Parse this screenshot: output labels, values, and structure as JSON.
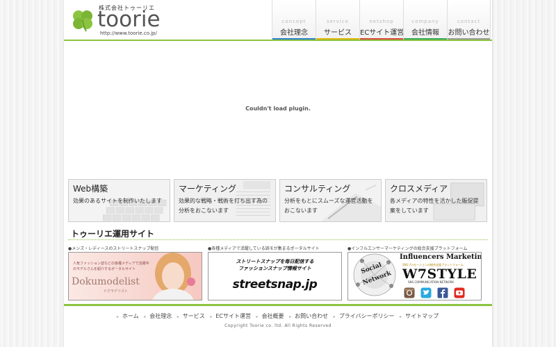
{
  "header": {
    "company_small": "株式会社トゥーリエ",
    "logo_word": "toorie",
    "url": "http://www.toorie.co.jp/"
  },
  "nav": [
    {
      "en": "concept",
      "ja": "会社理念",
      "color": "#2c7fc8"
    },
    {
      "en": "service",
      "ja": "サービス",
      "color": "#e0b50f"
    },
    {
      "en": "netshop",
      "ja": "ECサイト運営",
      "color": "#d94a3a"
    },
    {
      "en": "company",
      "ja": "会社情報",
      "color": "#39a95a"
    },
    {
      "en": "contact",
      "ja": "お問い合わせ",
      "color": "#9b9b9b"
    }
  ],
  "plugin_message": "Couldn't load plugin.",
  "services": [
    {
      "title": "Web構築",
      "desc": "効果のあるサイトを制作いたします"
    },
    {
      "title": "マーケティング",
      "desc": "効果的な戦略・戦術を打ち出す為の分析をおこないます"
    },
    {
      "title": "コンサルティング",
      "desc": "分析をもとにスムーズな運営活動をおこないます"
    },
    {
      "title": "クロスメディア",
      "desc": "各メディアの特性を活かした販促提案をしています"
    }
  ],
  "section_title": "トゥーリエ運用サイト",
  "sites": [
    {
      "label": "●メンズ・レディースのストリートスナップ配信",
      "banner_text_small": "人気ファッション誌などの各種メディアで活躍中のモデルさんを紹介するポータルサイト",
      "banner_logo": "Dokumodelist",
      "banner_logo_sub": "ドクモデリスト"
    },
    {
      "label": "●各種メディアで活躍している読モが集まるポータルサイト",
      "banner_line1": "ストリートスナップを毎日配信する",
      "banner_line2": "ファッションスナップ情報サイト",
      "banner_logo": "streetsnap.jp"
    },
    {
      "label": "●インフルエンサーマーケティングの総合支援プラットフォーム",
      "banner_title": "Influencers Marketing",
      "banner_sub": "SNSプロモーションの総合支援プラットフォーム",
      "banner_logo": "W7STYLE",
      "banner_logo_sub": "SNS COMMUNICATION NETWORK",
      "social_text_1": "Social",
      "social_text_2": "Network"
    }
  ],
  "footer": {
    "links": [
      "ホーム",
      "会社理念",
      "サービス",
      "ECサイト運営",
      "会社概要",
      "お問い合わせ",
      "プライバシーポリシー",
      "サイトマップ"
    ],
    "copyright": "Copyright Toorie co. ltd. All Rights Reserved"
  },
  "colors": {
    "accent_green": "#8bc43f"
  }
}
